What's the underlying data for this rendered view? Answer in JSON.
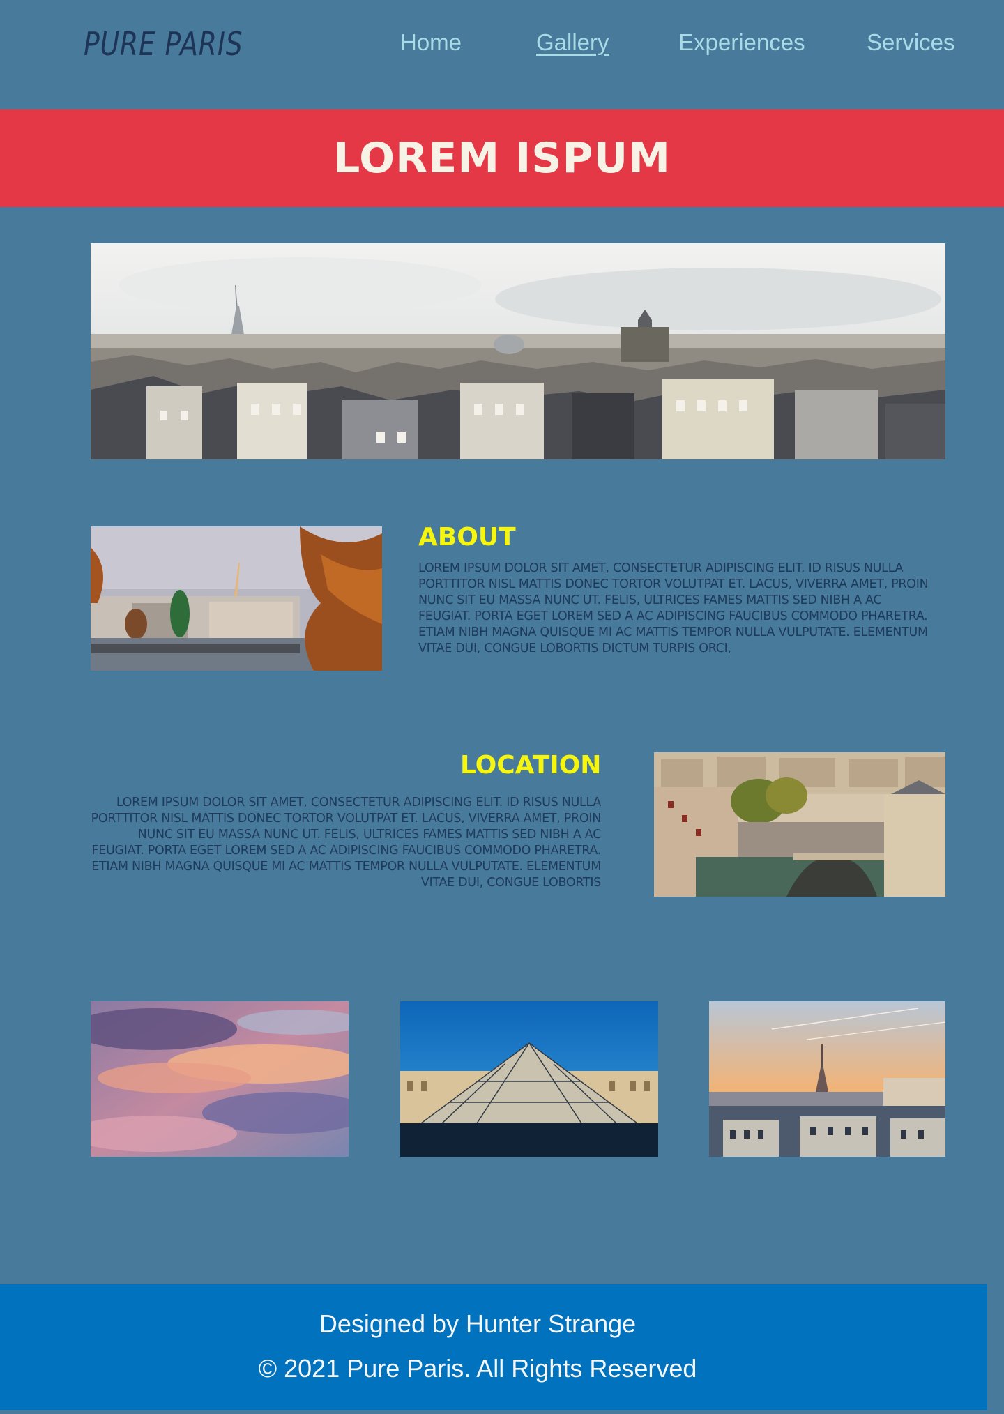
{
  "header": {
    "logo": "PURE PARIS",
    "nav": [
      {
        "label": "Home",
        "active": false
      },
      {
        "label": "Gallery",
        "active": true
      },
      {
        "label": "Experiences",
        "active": false
      },
      {
        "label": "Services",
        "active": false
      }
    ]
  },
  "banner": {
    "title": "LOREM ISPUM"
  },
  "about": {
    "title": "ABOUT",
    "text": "LOREM IPSUM DOLOR SIT AMET, CONSECTETUR ADIPISCING ELIT. ID RISUS NULLA PORTTITOR NISL MATTIS DONEC TORTOR VOLUTPAT ET. LACUS, VIVERRA AMET, PROIN NUNC SIT EU MASSA NUNC UT. FELIS, ULTRICES FAMES MATTIS SED NIBH A AC FEUGIAT. PORTA EGET LOREM SED A AC ADIPISCING FAUCIBUS COMMODO PHARETRA. ETIAM NIBH MAGNA QUISQUE MI AC MATTIS TEMPOR NULLA VULPUTATE. ELEMENTUM VITAE DUI, CONGUE LOBORTIS DICTUM TURPIS ORCI,"
  },
  "location": {
    "title": "LOCATION",
    "text": "LOREM IPSUM DOLOR SIT AMET, CONSECTETUR ADIPISCING ELIT. ID RISUS NULLA PORTTITOR NISL MATTIS DONEC TORTOR VOLUTPAT ET. LACUS, VIVERRA AMET, PROIN NUNC SIT EU MASSA NUNC UT. FELIS, ULTRICES FAMES MATTIS SED NIBH A AC FEUGIAT. PORTA EGET LOREM SED A AC ADIPISCING FAUCIBUS COMMODO PHARETRA. ETIAM NIBH MAGNA QUISQUE MI AC MATTIS TEMPOR NULLA VULPUTATE. ELEMENTUM VITAE DUI, CONGUE LOBORTIS"
  },
  "footer": {
    "credit": "Designed by Hunter Strange",
    "copyright": "© 2021 Pure Paris. All Rights Reserved"
  },
  "colors": {
    "page_bg": "#477a9b",
    "banner_bg": "#e53847",
    "heading_yellow": "#f6f50f",
    "nav_text": "#a9dbe6",
    "logo": "#1e3457",
    "footer_bg": "#0072be"
  }
}
